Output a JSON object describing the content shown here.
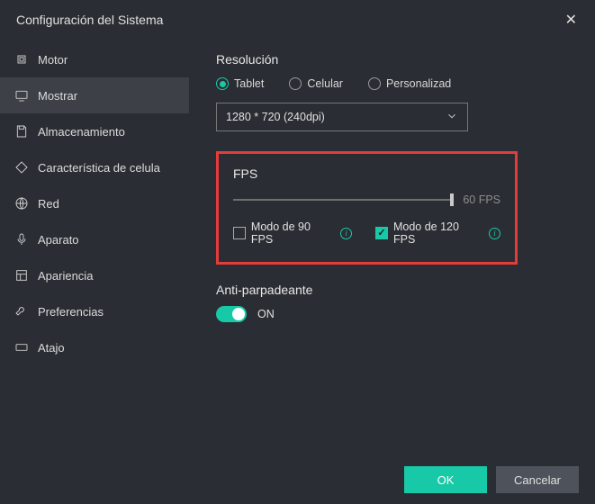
{
  "window": {
    "title": "Configuración del Sistema"
  },
  "sidebar": {
    "items": [
      {
        "label": "Motor"
      },
      {
        "label": "Mostrar"
      },
      {
        "label": "Almacenamiento"
      },
      {
        "label": "Característica de celula"
      },
      {
        "label": "Red"
      },
      {
        "label": "Aparato"
      },
      {
        "label": "Apariencia"
      },
      {
        "label": "Preferencias"
      },
      {
        "label": "Atajo"
      }
    ],
    "active_index": 1
  },
  "resolution": {
    "title": "Resolución",
    "options": [
      {
        "label": "Tablet",
        "selected": true
      },
      {
        "label": "Celular",
        "selected": false
      },
      {
        "label": "Personalizad",
        "selected": false
      }
    ],
    "select_value": "1280 * 720  (240dpi)"
  },
  "fps": {
    "title": "FPS",
    "slider_label": "60 FPS",
    "slider_value": 60,
    "slider_max": 60,
    "checks": [
      {
        "label": "Modo de 90 FPS",
        "checked": false
      },
      {
        "label": "Modo de 120 FPS",
        "checked": true
      }
    ]
  },
  "anti_flicker": {
    "title": "Anti-parpadeante",
    "state_label": "ON",
    "on": true
  },
  "footer": {
    "ok": "OK",
    "cancel": "Cancelar"
  },
  "colors": {
    "accent": "#17c9a6",
    "highlight_border": "#e43b3b"
  }
}
